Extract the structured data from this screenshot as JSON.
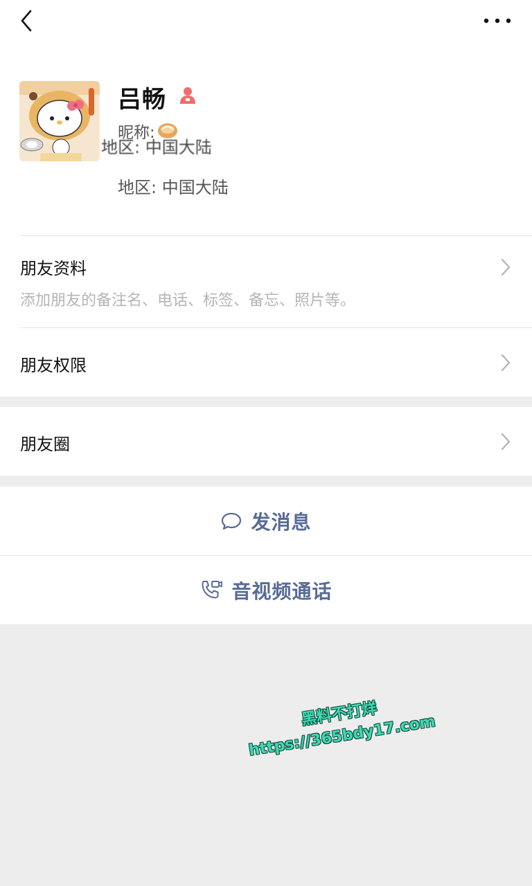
{
  "profile": {
    "name": "吕畅",
    "nickname_label": "昵称:",
    "ghost_region": "地区: 中国大陆",
    "region": "地区: 中国大陆"
  },
  "sections": {
    "friend_info_title": "朋友资料",
    "friend_info_sub": "添加朋友的备注名、电话、标签、备忘、照片等。",
    "permissions_title": "朋友权限",
    "moments_title": "朋友圈"
  },
  "actions": {
    "message_label": "发消息",
    "call_label": "音视频通话"
  },
  "watermark": {
    "line1": "黑料不打烊",
    "line2": "https://365bdy17.com"
  },
  "colors": {
    "link_blue": "#576b95",
    "page_bg": "#ededed",
    "gender_female": "#f06d6d"
  },
  "icons": {
    "back": "back-arrow-icon",
    "more": "more-dots-icon",
    "gender": "female-icon",
    "chevron": "chevron-right-icon",
    "message": "chat-bubble-icon",
    "call": "video-call-icon"
  }
}
